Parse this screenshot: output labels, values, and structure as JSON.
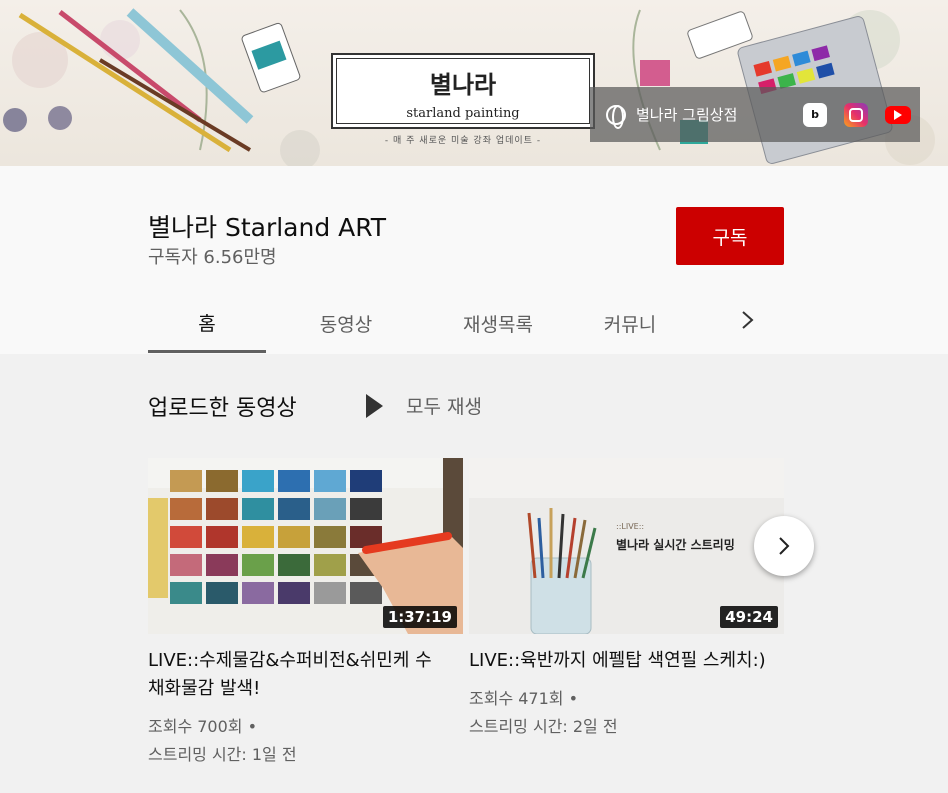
{
  "banner": {
    "title": "별나라",
    "subtitle": "starland painting",
    "tagline": "- 매 주 새로운 미술 강좌 업데이트 -",
    "link_label": "별나라 그림상점",
    "blog_icon_text": "b"
  },
  "channel": {
    "name": "별나라 Starland ART",
    "subscribers": "구독자 6.56만명",
    "subscribe_label": "구독"
  },
  "tabs": [
    {
      "label": "홈",
      "active": true
    },
    {
      "label": "동영상",
      "active": false
    },
    {
      "label": "재생목록",
      "active": false
    },
    {
      "label": "커뮤니",
      "active": false
    }
  ],
  "section": {
    "title": "업로드한 동영상",
    "play_all": "모두 재생"
  },
  "videos": [
    {
      "title": "LIVE::수제물감&수퍼비전&쉬민케 수채화물감 발색!",
      "duration": "1:37:19",
      "views": "조회수 700회 •",
      "streamed": "스트리밍 시간: 1일 전"
    },
    {
      "title": "LIVE::육반까지 에펠탑 색연필 스케치:)",
      "duration": "49:24",
      "views": "조회수 471회 •",
      "streamed": "스트리밍 시간: 2일 전",
      "thumb_label": "::LIVE::",
      "thumb_title": "별나라 실시간 스트리밍"
    }
  ],
  "colors": {
    "subscribe": "#cc0000",
    "background": "#f1f1f1",
    "header": "#f9f9f9"
  }
}
